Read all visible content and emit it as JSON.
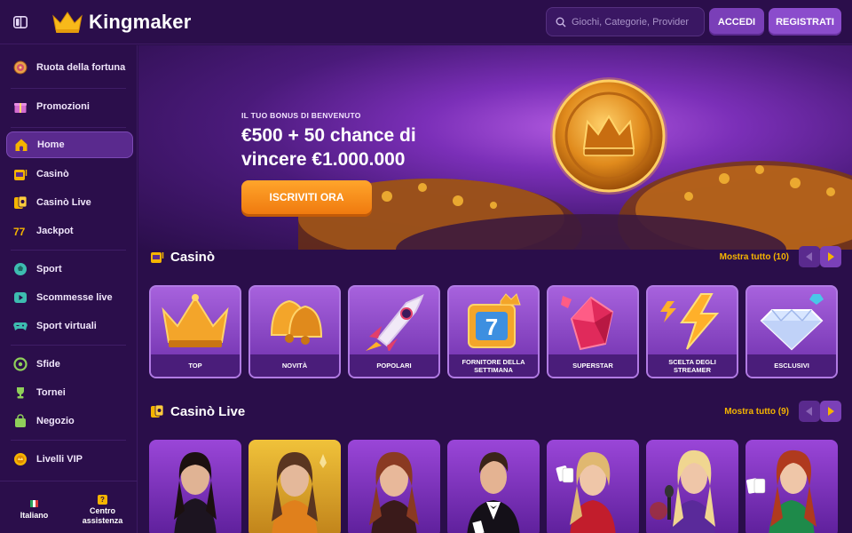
{
  "header": {
    "brand": "Kingmaker",
    "search_placeholder": "Giochi, Categorie, Provider",
    "login_label": "ACCEDI",
    "register_label": "REGISTRATI"
  },
  "sidebar": {
    "items": [
      {
        "label": "Ruota della fortuna",
        "icon": "fortune-wheel-icon"
      },
      {
        "label": "Promozioni",
        "icon": "gift-icon"
      },
      {
        "label": "Home",
        "icon": "home-icon",
        "active": true
      },
      {
        "label": "Casinò",
        "icon": "slot-machine-icon"
      },
      {
        "label": "Casinò Live",
        "icon": "live-cards-icon"
      },
      {
        "label": "Jackpot",
        "icon": "jackpot-icon"
      },
      {
        "label": "Sport",
        "icon": "soccer-ball-icon"
      },
      {
        "label": "Scommesse live",
        "icon": "live-play-icon"
      },
      {
        "label": "Sport virtuali",
        "icon": "gamepad-icon"
      },
      {
        "label": "Sfide",
        "icon": "challenge-icon"
      },
      {
        "label": "Tornei",
        "icon": "trophy-icon"
      },
      {
        "label": "Negozio",
        "icon": "shop-bag-icon"
      },
      {
        "label": "Livelli VIP",
        "icon": "vip-coin-icon"
      }
    ],
    "footer": {
      "language": "Italiano",
      "help_line1": "Centro",
      "help_line2": "assistenza",
      "help_icon_glyph": "?"
    }
  },
  "hero": {
    "subtitle": "IL TUO BONUS DI BENVENUTO",
    "title_line1": "€500 + 50 chance di",
    "title_line2": "vincere €1.000.000",
    "cta": "ISCRIVITI ORA"
  },
  "casino": {
    "title": "Casinò",
    "show_all": "Mostra tutto (10)",
    "cards": [
      {
        "label": "TOP",
        "icon": "crown-icon"
      },
      {
        "label": "NOVITÀ",
        "icon": "bell-icon"
      },
      {
        "label": "POPOLARI",
        "icon": "rocket-icon"
      },
      {
        "label": "FORNITORE DELLA SETTIMANA",
        "icon": "slot-seven-icon"
      },
      {
        "label": "SUPERSTAR",
        "icon": "ruby-icon"
      },
      {
        "label": "SCELTA DEGLI STREAMER",
        "icon": "lightning-icon"
      },
      {
        "label": "ESCLUSIVI",
        "icon": "diamond-icon"
      }
    ]
  },
  "casino_live": {
    "title": "Casinò Live",
    "show_all": "Mostra tutto (9)",
    "dealers": [
      {
        "name": "dealer-1"
      },
      {
        "name": "dealer-2"
      },
      {
        "name": "dealer-3"
      },
      {
        "name": "dealer-4"
      },
      {
        "name": "dealer-5"
      },
      {
        "name": "dealer-6"
      },
      {
        "name": "dealer-7"
      }
    ]
  },
  "colors": {
    "background": "#2a0e4a",
    "accent_gold": "#f5b400",
    "cta_orange": "#f07a0f",
    "button_purple": "#7a3fb8"
  }
}
